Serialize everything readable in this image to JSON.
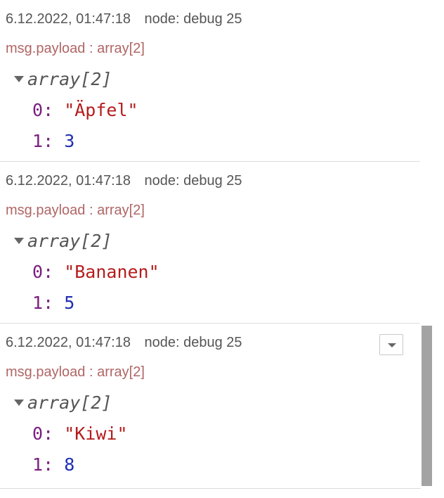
{
  "messages": [
    {
      "timestamp": "6.12.2022, 01:47:18",
      "node": "node: debug 25",
      "topic": "msg.payload : array[2]",
      "tree_label": "array[2]",
      "items": [
        {
          "key": "0",
          "value": "\"Äpfel\"",
          "type": "string"
        },
        {
          "key": "1",
          "value": "3",
          "type": "number"
        }
      ]
    },
    {
      "timestamp": "6.12.2022, 01:47:18",
      "node": "node: debug 25",
      "topic": "msg.payload : array[2]",
      "tree_label": "array[2]",
      "items": [
        {
          "key": "0",
          "value": "\"Bananen\"",
          "type": "string"
        },
        {
          "key": "1",
          "value": "5",
          "type": "number"
        }
      ]
    },
    {
      "timestamp": "6.12.2022, 01:47:18",
      "node": "node: debug 25",
      "topic": "msg.payload : array[2]",
      "tree_label": "array[2]",
      "items": [
        {
          "key": "0",
          "value": "\"Kiwi\"",
          "type": "string"
        },
        {
          "key": "1",
          "value": "8",
          "type": "number"
        }
      ]
    }
  ],
  "colors": {
    "topic": "#b06565",
    "key": "#7a1f80",
    "string": "#b51c1c",
    "number": "#1f2eb0",
    "meta": "#555555",
    "scroll_thumb": "#a3a3a3"
  },
  "icons": {
    "expand": "caret-down-icon",
    "menu": "dropdown-menu-icon"
  }
}
